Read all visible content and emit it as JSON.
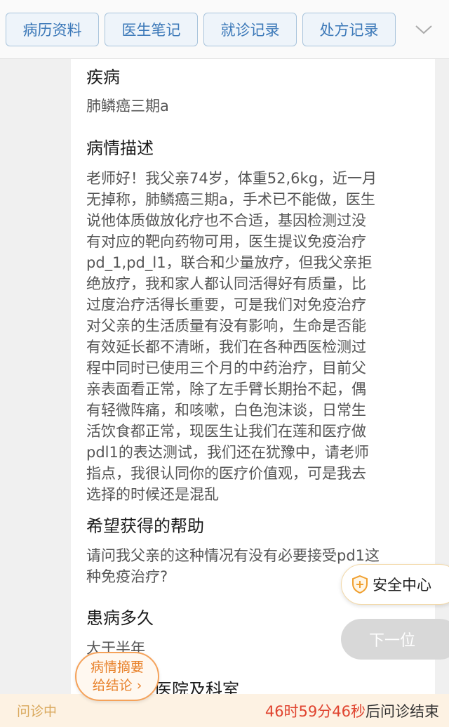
{
  "tabs": [
    {
      "label": "病历资料"
    },
    {
      "label": "医生笔记"
    },
    {
      "label": "就诊记录"
    },
    {
      "label": "处方记录"
    }
  ],
  "sections": {
    "disease": {
      "title": "疾病",
      "body": "肺鳞癌三期a"
    },
    "description": {
      "title": "病情描述",
      "lines": [
        "老师好！我父亲74岁，体重52,6kg，近一月",
        "无掉称，肺鳞癌三期a，手术已不能做，医生",
        "说他体质做放化疗也不合适，基因检测过没",
        "有对应的靶向药物可用，医生提议免疫治疗",
        "pd_1,pd_l1，联合和少量放疗，但我父亲拒",
        "绝放疗，我和家人都认同活得好有质量，比",
        "过度治疗活得长重要，可是我们对免疫治疗",
        "对父亲的生活质量有没有影响，生命是否能",
        "有效延长都不清晰，我们在各种西医检测过",
        "程中同时已使用三个月的中药治疗，目前父",
        "亲表面看正常，除了左手臂长期抬不起，偶",
        "有轻微阵痛，和咳嗽，白色泡沫谈，日常生",
        "活饮食都正常，现医生让我们在莲和医疗做",
        "pdl1的表达测试，我们还在犹豫中，请老师",
        "指点，我很认同你的医疗价值观，可是我去",
        "选择的时候还是混乱"
      ]
    },
    "help": {
      "title": "希望获得的帮助",
      "lines": [
        "请问我父亲的这种情况有没有必要接受pd1这",
        "种免疫治疗?"
      ]
    },
    "duration": {
      "title": "患病多久",
      "body": "大于半年"
    },
    "hospital": {
      "title": "医院及科室"
    }
  },
  "floating": {
    "security_label": "安全中心",
    "next_label": "下一位",
    "summary_line1": "病情摘要",
    "summary_line2": "给结论 ›"
  },
  "bottom": {
    "status": "问诊中",
    "countdown_time": "46时59分46秒",
    "countdown_suffix": "后问诊结束"
  },
  "colors": {
    "accent_blue": "#3b78b8",
    "accent_orange": "#e8822c",
    "countdown_red": "#e0442f"
  }
}
